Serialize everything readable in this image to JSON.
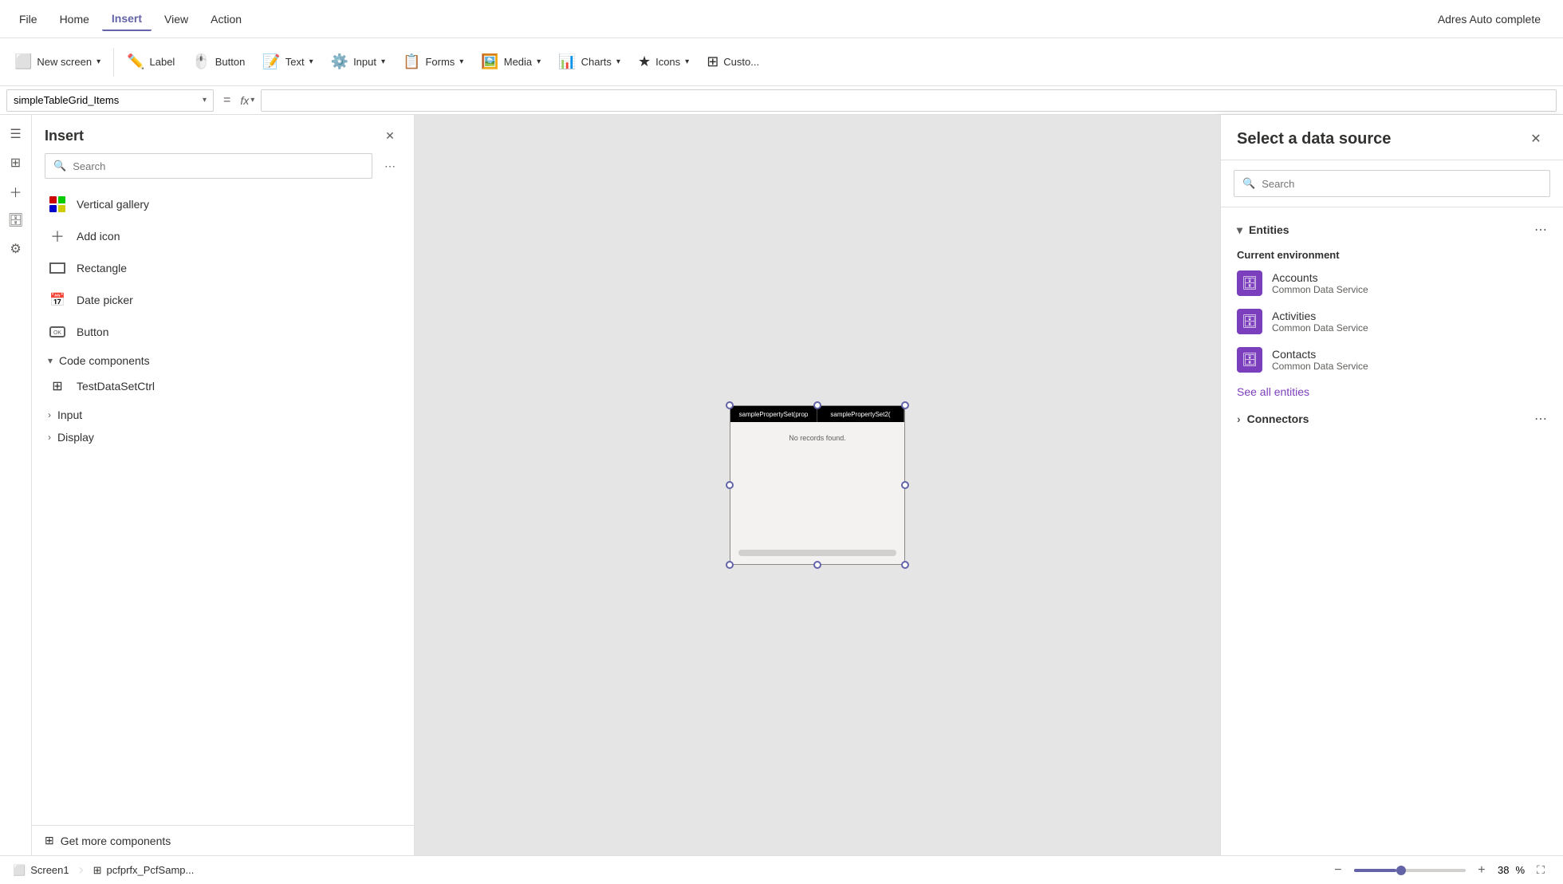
{
  "app": {
    "title": "Adres Auto complete"
  },
  "menu": {
    "items": [
      {
        "label": "File",
        "active": false
      },
      {
        "label": "Home",
        "active": false
      },
      {
        "label": "Insert",
        "active": true
      },
      {
        "label": "View",
        "active": false
      },
      {
        "label": "Action",
        "active": false
      }
    ]
  },
  "toolbar": {
    "new_screen_label": "New screen",
    "label_label": "Label",
    "button_label": "Button",
    "text_label": "Text",
    "input_label": "Input",
    "forms_label": "Forms",
    "media_label": "Media",
    "charts_label": "Charts",
    "icons_label": "Icons",
    "custom_label": "Custo..."
  },
  "formula_bar": {
    "selector_value": "simpleTableGrid_Items",
    "eq_symbol": "=",
    "fx_symbol": "fx"
  },
  "insert_panel": {
    "title": "Insert",
    "search_placeholder": "Search",
    "items": [
      {
        "label": "Vertical gallery",
        "icon": "grid"
      },
      {
        "label": "Add icon",
        "icon": "plus"
      },
      {
        "label": "Rectangle",
        "icon": "rect"
      },
      {
        "label": "Date picker",
        "icon": "calendar"
      },
      {
        "label": "Button",
        "icon": "button"
      }
    ],
    "sections": [
      {
        "label": "Code components",
        "expanded": true
      },
      {
        "label": "Input",
        "expanded": false
      },
      {
        "label": "Display",
        "expanded": false
      }
    ],
    "code_items": [
      {
        "label": "TestDataSetCtrl",
        "icon": "grid"
      }
    ],
    "get_more_label": "Get more components"
  },
  "canvas": {
    "header_col1": "samplePropertySet(prop",
    "header_col2": "samplePropertySet2(",
    "no_records_text": "No records found."
  },
  "data_source_panel": {
    "title": "Select a data source",
    "search_placeholder": "Search",
    "entities_label": "Entities",
    "current_environment_label": "Current environment",
    "entities": [
      {
        "name": "Accounts",
        "sub": "Common Data Service"
      },
      {
        "name": "Activities",
        "sub": "Common Data Service"
      },
      {
        "name": "Contacts",
        "sub": "Common Data Service"
      }
    ],
    "see_all_label": "See all entities",
    "connectors_label": "Connectors"
  },
  "status_bar": {
    "screen1_label": "Screen1",
    "component_label": "pcfprfx_PcfSamp...",
    "zoom_value": "38",
    "zoom_unit": "%",
    "zoom_minus": "−",
    "zoom_plus": "+"
  }
}
